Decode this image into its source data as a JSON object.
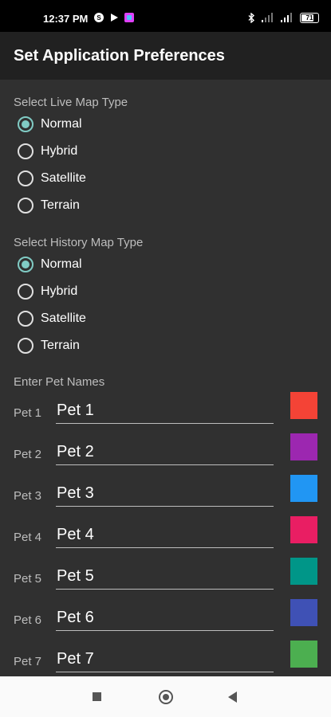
{
  "status_bar": {
    "time": "12:37 PM",
    "battery": "71",
    "left_icons": [
      "skype-icon",
      "play-icon",
      "app-icon"
    ],
    "right_icons": [
      "bluetooth-icon",
      "signal-icon",
      "signal-icon",
      "battery-icon"
    ]
  },
  "appbar": {
    "title": "Set Application Preferences"
  },
  "live_map": {
    "label": "Select Live Map Type",
    "options": [
      "Normal",
      "Hybrid",
      "Satellite",
      "Terrain"
    ],
    "selected": "Normal"
  },
  "history_map": {
    "label": "Select History Map Type",
    "options": [
      "Normal",
      "Hybrid",
      "Satellite",
      "Terrain"
    ],
    "selected": "Normal"
  },
  "pets": {
    "label": "Enter Pet Names",
    "rows": [
      {
        "label": "Pet 1",
        "value": "Pet 1",
        "color": "#f44336"
      },
      {
        "label": "Pet 2",
        "value": "Pet 2",
        "color": "#9c27b0"
      },
      {
        "label": "Pet 3",
        "value": "Pet 3",
        "color": "#2196f3"
      },
      {
        "label": "Pet 4",
        "value": "Pet 4",
        "color": "#e91e63"
      },
      {
        "label": "Pet 5",
        "value": "Pet 5",
        "color": "#009688"
      },
      {
        "label": "Pet 6",
        "value": "Pet 6",
        "color": "#3f51b5"
      },
      {
        "label": "Pet 7",
        "value": "Pet 7",
        "color": "#4caf50"
      }
    ]
  },
  "colors": {
    "accent": "#80cbc4",
    "background": "#303030",
    "appbar": "#212121"
  }
}
